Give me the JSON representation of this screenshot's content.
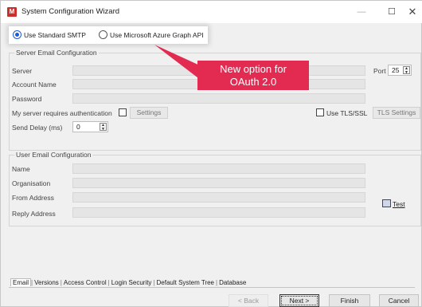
{
  "window": {
    "title": "System Configuration Wizard",
    "icon_letter": "M",
    "min_glyph": "—",
    "max_glyph": "☐",
    "close_glyph": "✕"
  },
  "auth_options": {
    "smtp_label": "Use Standard SMTP",
    "smtp_selected": true,
    "azure_label": "Use Microsoft Azure Graph API",
    "azure_selected": false
  },
  "server_group": {
    "title": "Server Email Configuration",
    "server_label": "Server",
    "server_value": "",
    "account_label": "Account Name",
    "account_value": "",
    "password_label": "Password",
    "password_value": "",
    "auth_label": "My server requires authentication",
    "settings_button": "Settings",
    "port_label": "Port",
    "port_value": "25",
    "tls_label": "Use TLS/SSL",
    "tls_settings_button": "TLS Settings",
    "send_delay_label": "Send Delay (ms)",
    "send_delay_value": "0"
  },
  "user_group": {
    "title": "User Email Configuration",
    "name_label": "Name",
    "org_label": "Organisation",
    "from_label": "From Address",
    "reply_label": "Reply Address",
    "test_button": "Test"
  },
  "callout": {
    "line1": "New option for",
    "line2": "OAuth 2.0",
    "color": "#e32b52"
  },
  "tabs": [
    "Email",
    "Versions",
    "Access Control",
    "Login Security",
    "Default System Tree",
    "Database"
  ],
  "footer": {
    "back": "< Back",
    "next": "Next >",
    "finish": "Finish",
    "cancel": "Cancel"
  },
  "colors": {
    "accent": "#1a5cd8",
    "brand": "#c9302c"
  }
}
